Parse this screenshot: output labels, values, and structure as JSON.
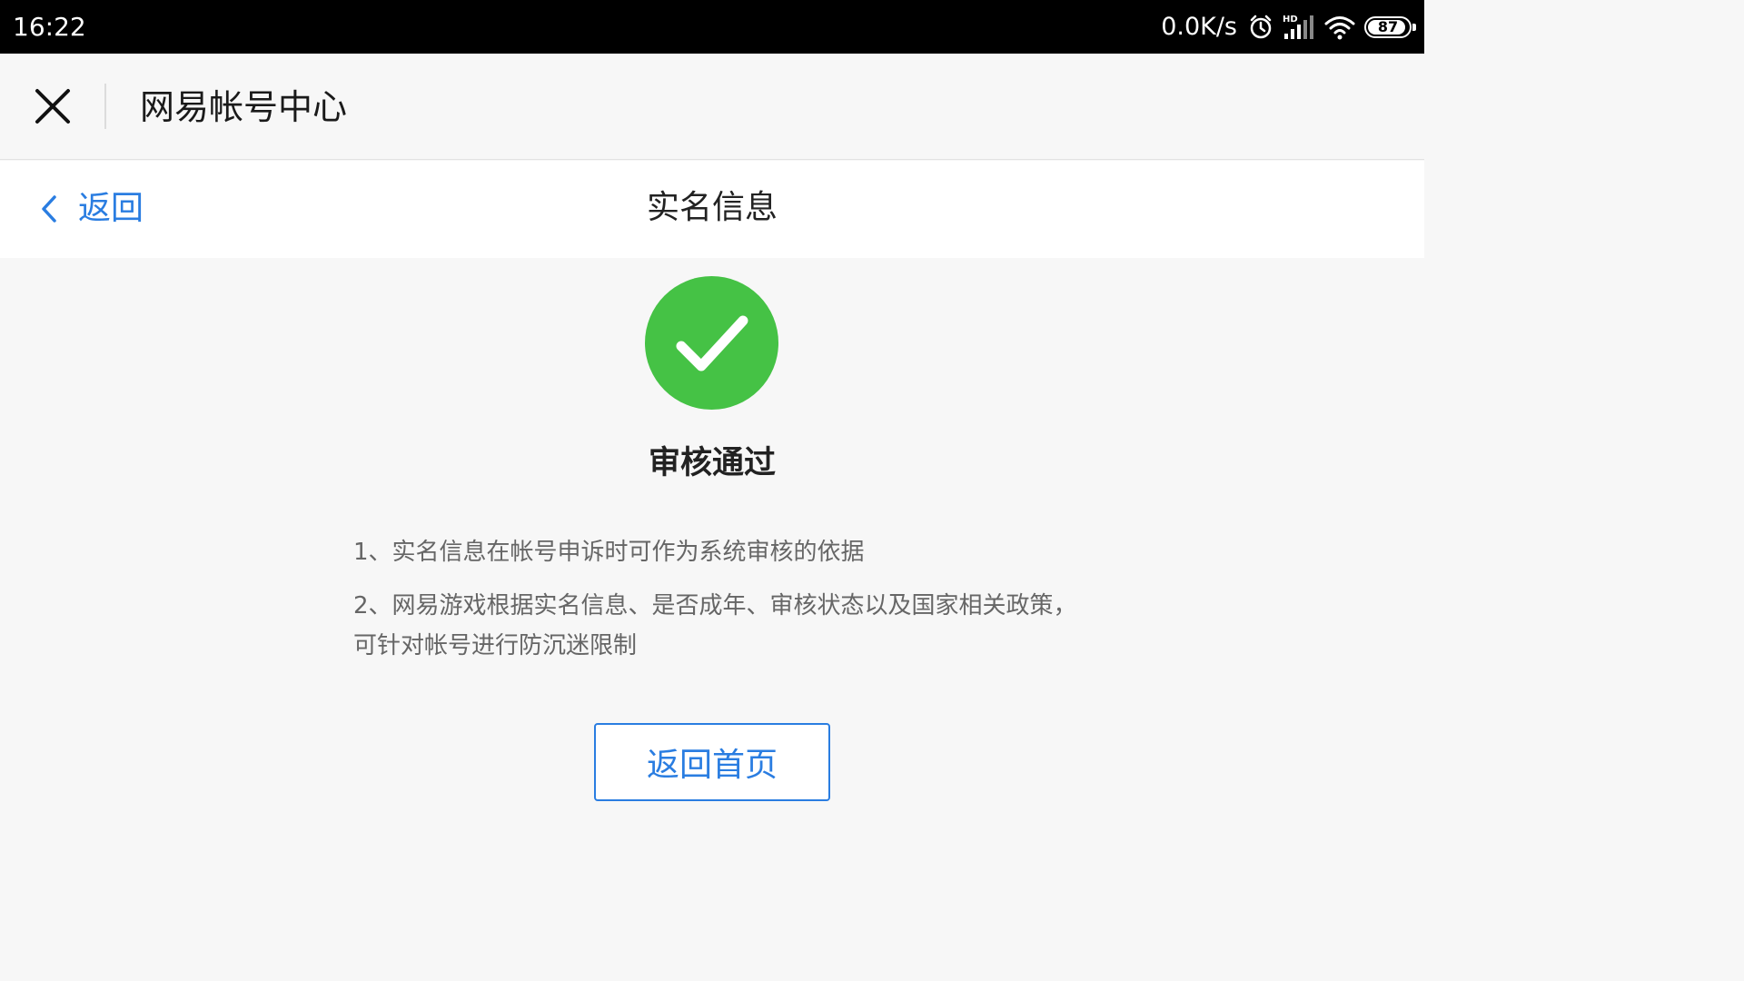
{
  "status_bar": {
    "time": "16:22",
    "net_speed": "0.0K/s",
    "icons": [
      "alarm-icon",
      "hd-signal-icon",
      "wifi-icon",
      "battery-icon"
    ],
    "battery_level": "87"
  },
  "webview": {
    "title": "网易帐号中心",
    "close_icon": "close-icon"
  },
  "nav": {
    "back_label": "返回",
    "title": "实名信息"
  },
  "result": {
    "icon": "check-circle-icon",
    "icon_color": "#45c245",
    "status": "审核通过"
  },
  "notes": [
    "1、实名信息在帐号申诉时可作为系统审核的依据",
    "2、网易游戏根据实名信息、是否成年、审核状态以及国家相关政策，可针对帐号进行防沉迷限制"
  ],
  "home_button_label": "返回首页",
  "colors": {
    "accent": "#2a7de1",
    "success": "#45c245"
  }
}
